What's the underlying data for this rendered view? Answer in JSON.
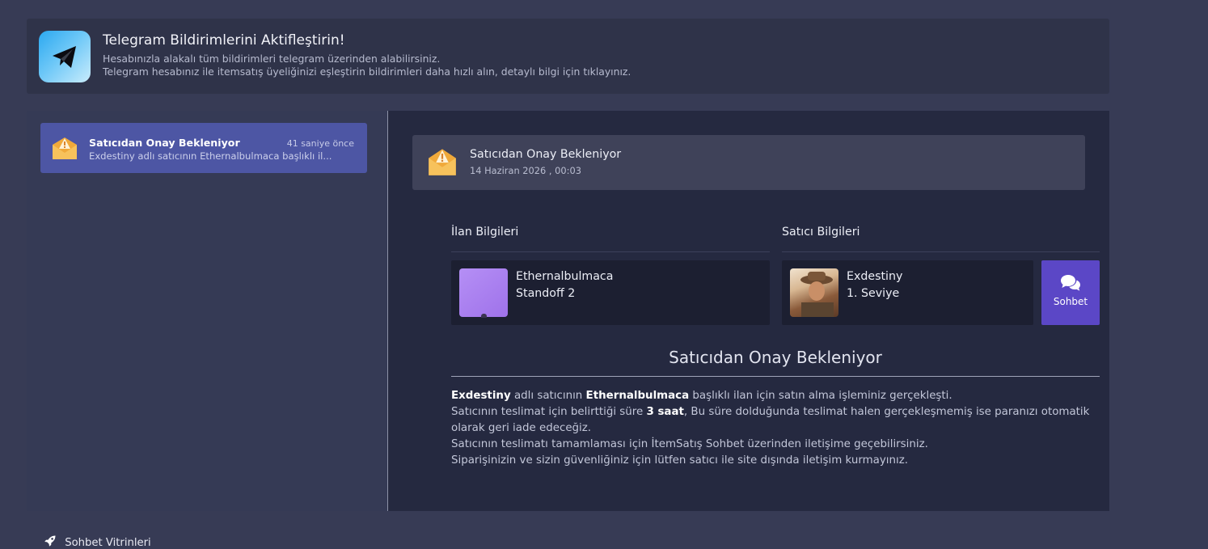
{
  "telegram_banner": {
    "title": "Telegram Bildirimlerini Aktifleştirin!",
    "line1": "Hesabınızla alakalı tüm bildirimleri telegram üzerinden alabilirsiniz.",
    "line2": "Telegram hesabınız ile itemsatış üyeliğinizi eşleştirin bildirimleri daha hızlı alın, detaylı bilgi için tıklayınız.",
    "icon": "telegram-icon",
    "accent_color": "#2ba8f0"
  },
  "notifications": [
    {
      "title": "Satıcıdan Onay Bekleniyor",
      "time": "41 saniye önce",
      "preview": "Exdestiny adlı satıcının Ethernalbulmaca başlıklı il...",
      "icon": "envelope-warning-icon",
      "selected": true
    }
  ],
  "detail": {
    "header": {
      "title": "Satıcıdan Onay Bekleniyor",
      "date": "14 Haziran 2026 , 00:03",
      "icon": "envelope-warning-icon"
    },
    "listing_section": {
      "title": "İlan Bilgileri",
      "name": "Ethernalbulmaca",
      "game": "Standoff 2"
    },
    "seller_section": {
      "title": "Satıcı Bilgileri",
      "name": "Exdestiny",
      "level": "1. Seviye"
    },
    "chat_button": {
      "label": "Sohbet",
      "icon": "chat-bubbles-icon",
      "color": "#5b47c6"
    },
    "status_title": "Satıcıdan Onay Bekleniyor",
    "message": {
      "p1_seller": "Exdestiny",
      "p1_text1": " adlı satıcının ",
      "p1_listing": "Ethernalbulmaca",
      "p1_text2": " başlıklı ilan için satın alma işleminiz gerçekleşti.",
      "p2_text1": "Satıcının teslimat için belirttiği süre ",
      "p2_duration": "3 saat",
      "p2_text2": ", Bu süre dolduğunda teslimat halen gerçekleşmemiş ise paranızı otomatik",
      "p3": "olarak geri iade edeceğiz.",
      "p4": "Satıcının teslimatı tamamlaması için İtemSatış Sohbet üzerinden iletişime geçebilirsiniz.",
      "p5": "Siparişinizin ve sizin güvenliğiniz için lütfen satıcı ile site dışında iletişim kurmayınız."
    }
  },
  "footer": {
    "link_label": "Sohbet Vitrinleri",
    "icon": "rocket-icon"
  }
}
